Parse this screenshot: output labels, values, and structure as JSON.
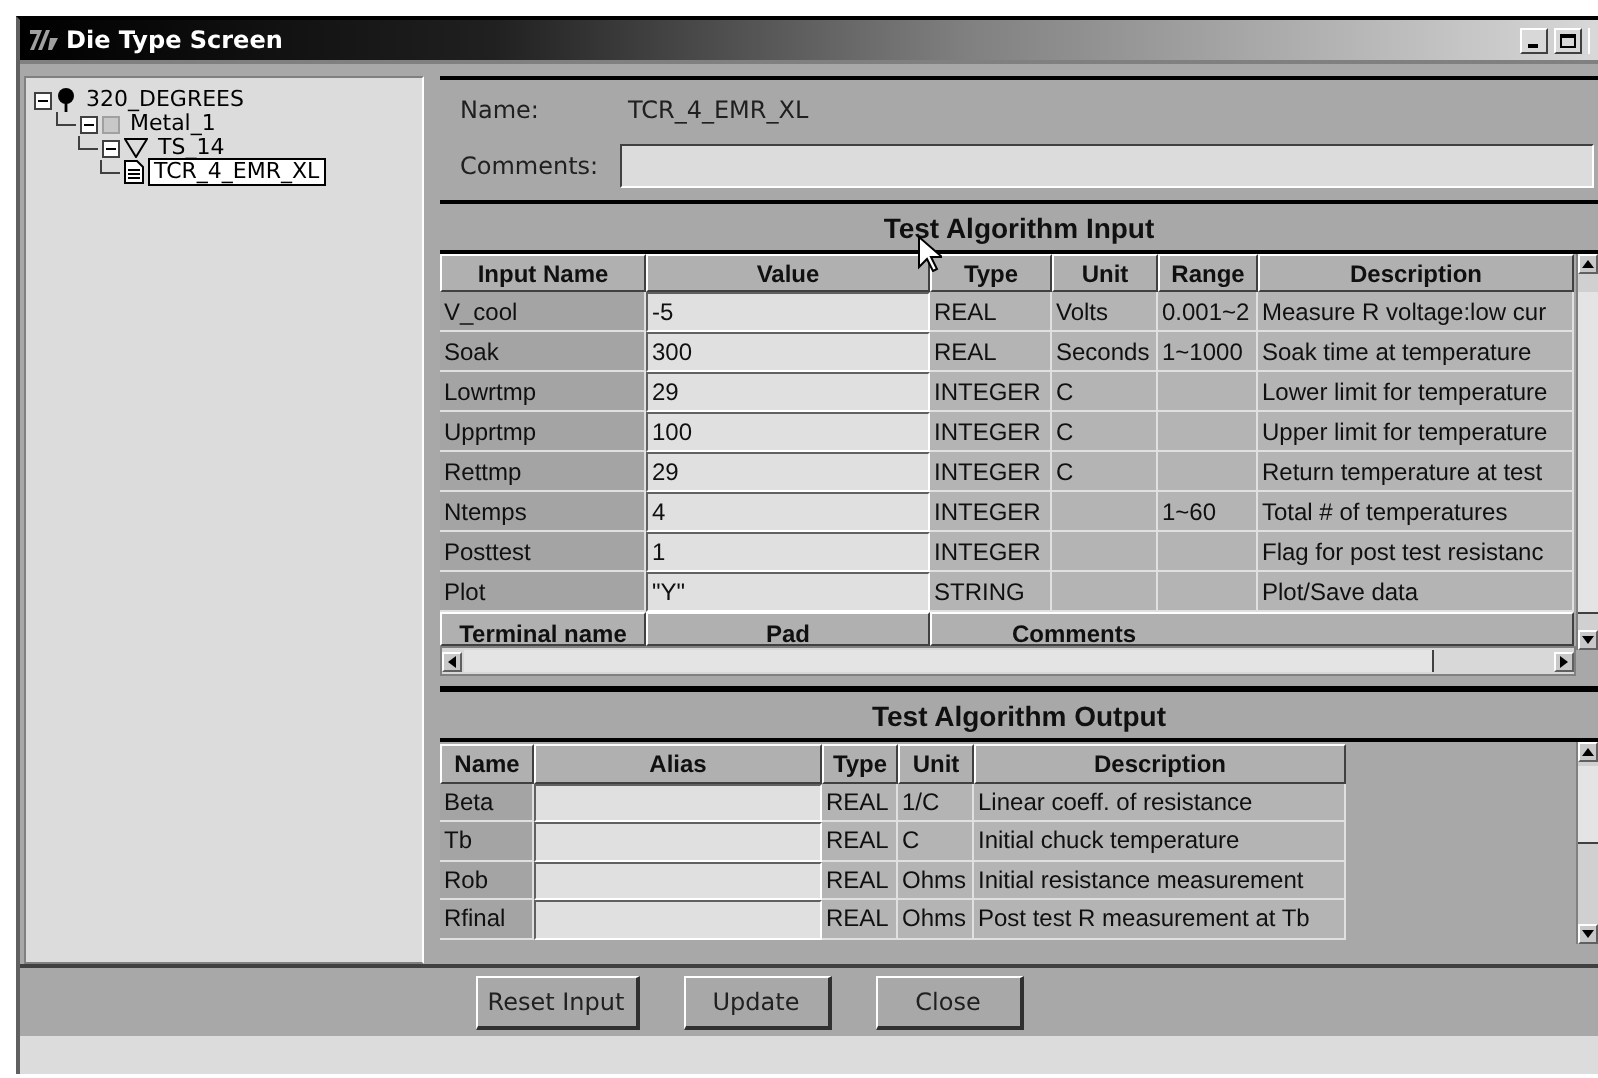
{
  "window": {
    "title": "Die Type Screen"
  },
  "tree": [
    {
      "label": "320_DEGREES",
      "kind": "die",
      "expanded": true,
      "selected": false,
      "children": [
        {
          "label": "Metal_1",
          "kind": "layer",
          "expanded": true,
          "selected": false,
          "children": [
            {
              "label": "TS_14",
              "kind": "structure",
              "expanded": true,
              "selected": false,
              "children": [
                {
                  "label": "TCR_4_EMR_XL",
                  "kind": "test",
                  "selected": true
                }
              ]
            }
          ]
        }
      ]
    }
  ],
  "details": {
    "name_label": "Name:",
    "name_value": "TCR_4_EMR_XL",
    "comments_label": "Comments:"
  },
  "input_table": {
    "title": "Test Algorithm Input",
    "columns": [
      "Input Name",
      "Value",
      "Type",
      "Unit",
      "Range",
      "Description"
    ],
    "rows": [
      {
        "name": "V_cool",
        "value": "-5",
        "type": "REAL",
        "unit": "Volts",
        "range": "0.001~2",
        "description": "Measure R voltage:low cur"
      },
      {
        "name": "Soak",
        "value": "300",
        "type": "REAL",
        "unit": "Seconds",
        "range": "1~1000",
        "description": "Soak time at temperature"
      },
      {
        "name": "Lowrtmp",
        "value": "29",
        "type": "INTEGER",
        "unit": "C",
        "description": "Lower limit for temperature"
      },
      {
        "name": "Upprtmp",
        "value": "100",
        "type": "INTEGER",
        "unit": "C",
        "description": "Upper limit for temperature"
      },
      {
        "name": "Rettmp",
        "value": "29",
        "type": "INTEGER",
        "unit": "C",
        "description": "Return temperature at test"
      },
      {
        "name": "Ntemps",
        "value": "4",
        "type": "INTEGER",
        "range": "1~60",
        "description": "Total # of temperatures"
      },
      {
        "name": "Posttest",
        "value": "1",
        "type": "INTEGER",
        "description": "Flag for post test resistanc"
      },
      {
        "name": "Plot",
        "value": "\"Y\"",
        "type": "STRING",
        "description": "Plot/Save data"
      }
    ],
    "terminal_columns": [
      "Terminal name",
      "Pad",
      "Comments"
    ]
  },
  "output_table": {
    "title": "Test Algorithm Output",
    "columns": [
      "Name",
      "Alias",
      "Type",
      "Unit",
      "Description"
    ],
    "rows": [
      {
        "name": "Beta",
        "type": "REAL",
        "unit": "1/C",
        "description": "Linear coeff. of resistance"
      },
      {
        "name": "Tb",
        "type": "REAL",
        "unit": "C",
        "description": "Initial chuck temperature"
      },
      {
        "name": "Rob",
        "type": "REAL",
        "unit": "Ohms",
        "description": "Initial resistance measurement"
      },
      {
        "name": "Rfinal",
        "type": "REAL",
        "unit": "Ohms",
        "description": "Post test R measurement at Tb"
      }
    ]
  },
  "buttons": [
    "Reset Input",
    "Update",
    "Close"
  ]
}
